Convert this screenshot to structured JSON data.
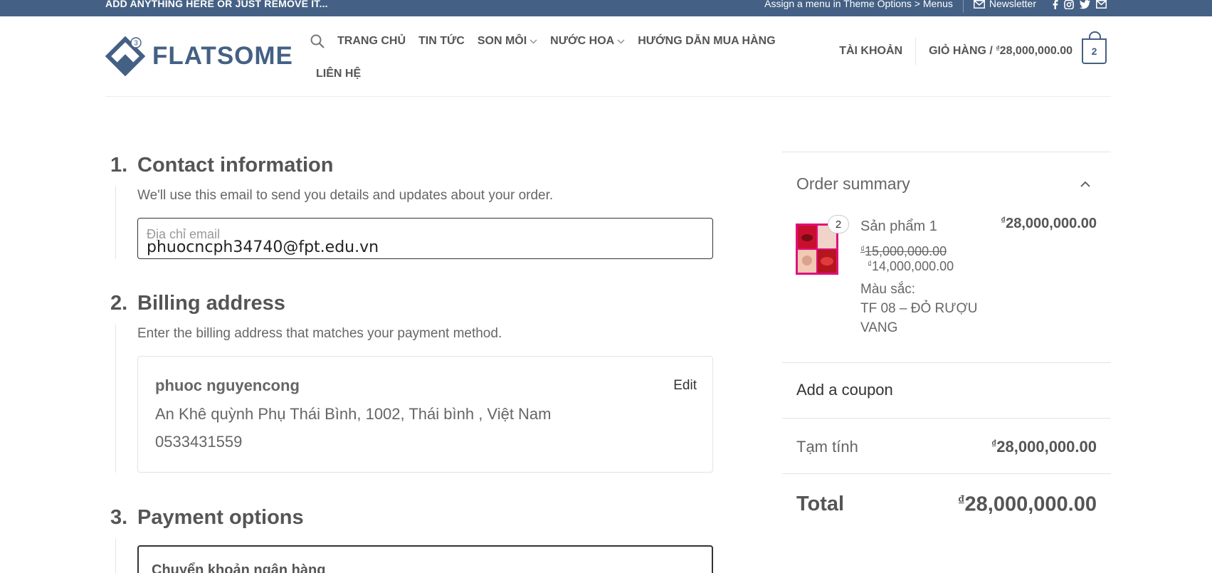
{
  "topbar": {
    "left_text": "ADD ANYTHING HERE OR JUST REMOVE IT...",
    "menu_text": "Assign a menu in Theme Options > Menus",
    "newsletter": "Newsletter",
    "socials": [
      "facebook-icon",
      "instagram-icon",
      "twitter-icon",
      "email-icon"
    ],
    "bg_color": "#446084"
  },
  "header": {
    "logo_text": "FLATSOME",
    "logo_badge": "3",
    "nav": {
      "home": "TRANG CHỦ",
      "news": "TIN TỨC",
      "lipstick": "SON MÔI",
      "perfume": "NƯỚC HOA",
      "guide": "HƯỚNG DẪN MUA HÀNG",
      "contact": "LIÊN HỆ"
    },
    "account": "TÀI KHOẢN",
    "cart_label": "GIỎ HÀNG /",
    "cart_total": "28,000,000.00",
    "cart_currency": "₫",
    "cart_count": "2"
  },
  "contact": {
    "number": "1.",
    "title": "Contact information",
    "desc": "We'll use this email to send you details and updates about your order.",
    "email_label": "Địa chỉ email",
    "email_value": "phuocncph34740@fpt.edu.vn"
  },
  "billing": {
    "number": "2.",
    "title": "Billing address",
    "desc": "Enter the billing address that matches your payment method.",
    "name": "phuoc nguyencong",
    "edit": "Edit",
    "address": "An Khê quỳnh Phụ Thái Bình, 1002, Thái bình , Việt Nam",
    "phone": "0533431559"
  },
  "payment": {
    "number": "3.",
    "title": "Payment options",
    "option_label": "Chuyển khoản ngân hàng"
  },
  "summary": {
    "title": "Order summary",
    "product": {
      "qty": "2",
      "name": "Sản phẩm 1",
      "price": "28,000,000.00",
      "old_price": "15,000,000.00",
      "new_price": "14,000,000.00",
      "attr_label": "Màu sắc:",
      "attr_value_1": "TF 08 – ĐỎ RƯỢU",
      "attr_value_2": "VANG"
    },
    "coupon": "Add a coupon",
    "subtotal_label": "Tạm tính",
    "subtotal": "28,000,000.00",
    "total_label": "Total",
    "total": "28,000,000.00",
    "currency": "₫"
  },
  "colors": {
    "primary": "#446084",
    "text": "#555555",
    "border": "#e3e3e3"
  }
}
